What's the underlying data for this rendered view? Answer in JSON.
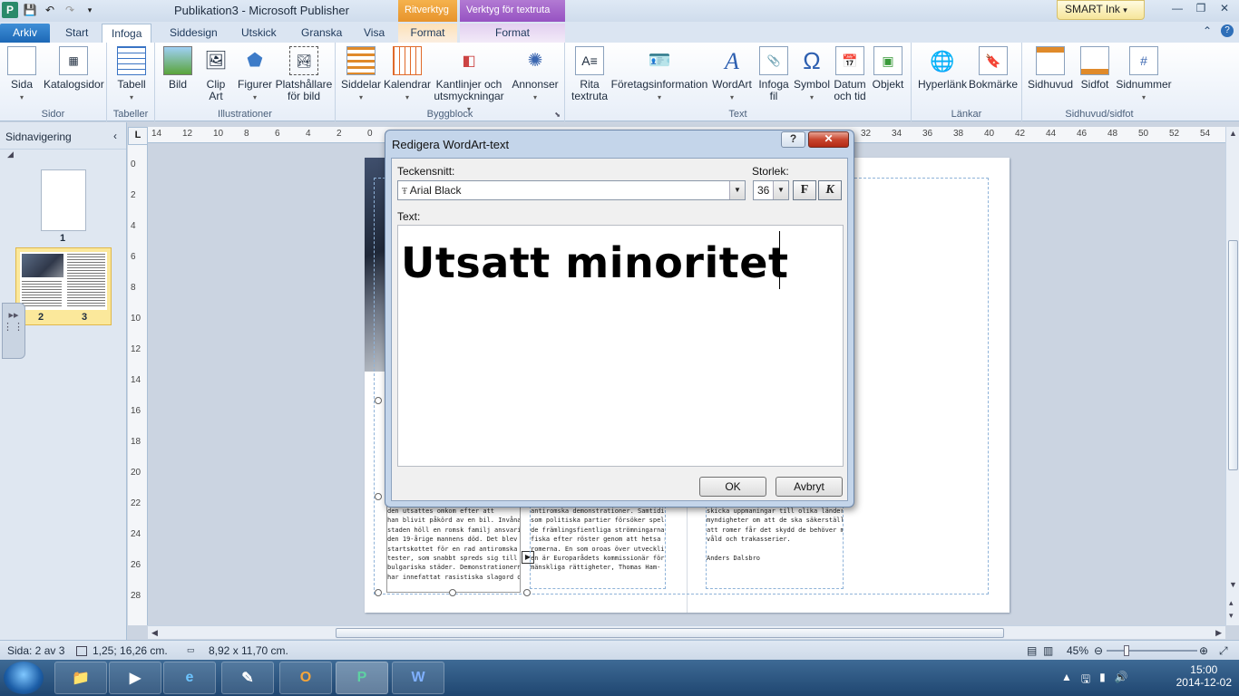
{
  "window": {
    "title": "Publikation3  -  Microsoft Publisher",
    "context_tab_drawing": "Ritverktyg",
    "context_tab_textbox": "Verktyg för textruta",
    "smart_ink": "SMART Ink"
  },
  "tabs": [
    "Arkiv",
    "Start",
    "Infoga",
    "Siddesign",
    "Utskick",
    "Granska",
    "Visa",
    "Format",
    "Format"
  ],
  "ribbon": {
    "groups": {
      "sidor": "Sidor",
      "tabeller": "Tabeller",
      "illustrationer": "Illustrationer",
      "byggblock": "Byggblock",
      "text": "Text",
      "lankar": "Länkar",
      "sidhuvud": "Sidhuvud/sidfot"
    },
    "buttons": {
      "sida": "Sida",
      "katalogsidor": "Katalogsidor",
      "tabell": "Tabell",
      "bild": "Bild",
      "clipart1": "Clip",
      "clipart2": "Art",
      "figurer": "Figurer",
      "platshallare1": "Platshållare",
      "platshallare2": "för bild",
      "siddelar": "Siddelar",
      "kalendrar": "Kalendrar",
      "kantlinjer1": "Kantlinjer och",
      "kantlinjer2": "utsmyckningar",
      "annonser": "Annonser",
      "rita1": "Rita",
      "rita2": "textruta",
      "foretagsinfo": "Företagsinformation",
      "wordart": "WordArt",
      "infogafil1": "Infoga",
      "infogafil2": "fil",
      "symbol": "Symbol",
      "datum1": "Datum",
      "datum2": "och tid",
      "objekt": "Objekt",
      "hyperlank": "Hyperlänk",
      "bokmarke": "Bokmärke",
      "sidhuvud": "Sidhuvud",
      "sidfot": "Sidfot",
      "sidnummer": "Sidnummer"
    }
  },
  "navpane": {
    "title": "Sidnavigering",
    "page1": "1",
    "page2": "2",
    "page3": "3"
  },
  "ruler": {
    "corner": "L",
    "h_ticks": [
      "14",
      "12",
      "10",
      "8",
      "6",
      "4",
      "2",
      "0",
      "2",
      "4",
      "6",
      "8",
      "10",
      "12",
      "14",
      "16",
      "18",
      "20",
      "22",
      "24",
      "26",
      "28",
      "30",
      "32",
      "34",
      "36",
      "38",
      "40",
      "42",
      "44",
      "46",
      "48",
      "50",
      "52",
      "54"
    ],
    "v_ticks": [
      "0",
      "2",
      "4",
      "6",
      "8",
      "10",
      "12",
      "14",
      "16",
      "18",
      "20",
      "22",
      "24",
      "26",
      "28"
    ]
  },
  "document": {
    "col1": [
      "den utsattes omkom efter att",
      "han blivit påkörd av en bil. Invånare i",
      "staden höll en romsk familj ansvarig för",
      "den 19-årige mannens död. Det blev",
      "startskottet för en rad antiromska pro-",
      "tester, som snabbt spreds sig till flera",
      "bulgariska städer. Demonstrationerna",
      "har innefattat rasistiska slagord och för-"
    ],
    "col2": [
      "antiromska demonstrationer. Samtidigt",
      "som politiska partier försöker spela på",
      "de främlingsfientliga strömningarna och",
      "fiska efter röster genom att hetsa mot",
      "romerna. En som oroas över utveckling-",
      "en är Europarådets kommissionär för",
      "mänskliga rättigheter, Thomas Ham-"
    ],
    "col3": [
      "skicka uppmaningar till olika länders",
      "myndigheter om att de ska säkerställa",
      "att romer får det skydd de behöver mot",
      "våld och trakasserier.",
      "",
      "Anders Dalsbro"
    ]
  },
  "statusbar": {
    "page": "Sida: 2 av 3",
    "position": "1,25; 16,26 cm.",
    "size": "8,92 x 11,70 cm.",
    "zoom": "45%"
  },
  "taskbar": {
    "time": "15:00",
    "date": "2014-12-02"
  },
  "dialog": {
    "title": "Redigera WordArt-text",
    "help": "?",
    "close": "✕",
    "font_label": "Teckensnitt:",
    "font_value": "Arial Black",
    "size_label": "Storlek:",
    "size_value": "36",
    "bold": "F",
    "italic": "K",
    "text_label": "Text:",
    "text_value": "Utsatt minoritet",
    "ok": "OK",
    "cancel": "Avbryt"
  },
  "colors": {
    "file_tab": "#1d68b6",
    "ctx_drawing": "#e7942c",
    "ctx_textbox": "#9652c2",
    "close_button": "#c8452e"
  }
}
